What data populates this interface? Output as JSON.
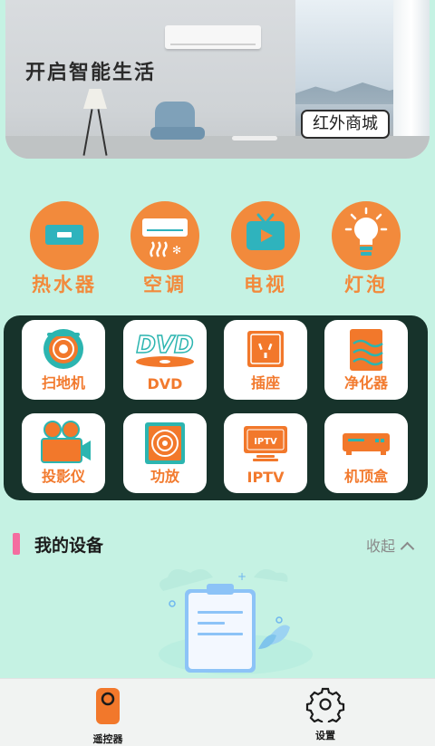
{
  "banner": {
    "title": "开启智能生活",
    "mall_button": "红外商城"
  },
  "categories": [
    {
      "label": "热水器",
      "icon": "water-heater-icon"
    },
    {
      "label": "空调",
      "icon": "air-conditioner-icon"
    },
    {
      "label": "电视",
      "icon": "tv-icon"
    },
    {
      "label": "灯泡",
      "icon": "light-bulb-icon"
    }
  ],
  "devices": [
    {
      "label": "扫地机",
      "icon": "robot-vacuum-icon"
    },
    {
      "label": "DVD",
      "icon": "dvd-icon"
    },
    {
      "label": "插座",
      "icon": "socket-icon"
    },
    {
      "label": "净化器",
      "icon": "air-purifier-icon"
    },
    {
      "label": "投影仪",
      "icon": "projector-icon"
    },
    {
      "label": "功放",
      "icon": "amplifier-icon"
    },
    {
      "label": "IPTV",
      "icon": "iptv-icon"
    },
    {
      "label": "机顶盒",
      "icon": "set-top-box-icon"
    }
  ],
  "my_devices": {
    "title": "我的设备",
    "collapse_label": "收起"
  },
  "nav": {
    "remote_label": "遥控器",
    "settings_label": "设置"
  },
  "colors": {
    "background": "#c5f2e3",
    "accent": "#f28a3c",
    "panel": "#17332b",
    "device_icon": "#f2782b",
    "section_marker": "#f46ea0"
  }
}
